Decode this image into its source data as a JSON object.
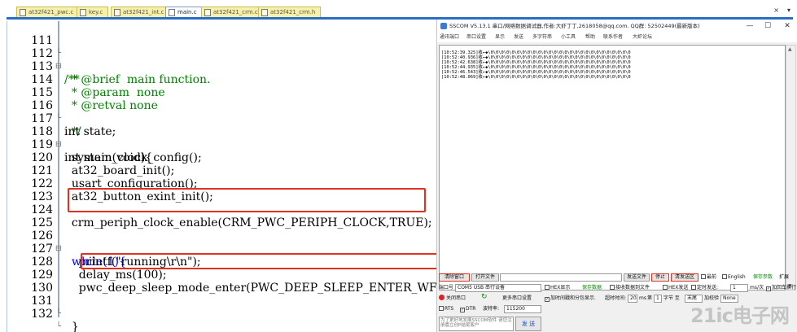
{
  "tabs": [
    {
      "label": "at32f421_pwc.c",
      "active": false
    },
    {
      "label": "key.c",
      "active": false
    },
    {
      "label": "at32f421_int.c",
      "active": false
    },
    {
      "label": "main.c",
      "active": true
    },
    {
      "label": "at32f421_crm.c",
      "active": false
    },
    {
      "label": "at32f421_crm.h",
      "active": false
    }
  ],
  "tabbar_controls": {
    "dropdown": "▾",
    "close": "×"
  },
  "editor": {
    "lines": [
      {
        "n": "111",
        "fold": "└",
        "code": ""
      },
      {
        "n": "112",
        "fold": "⊟",
        "code": "/**"
      },
      {
        "n": "113",
        "fold": "",
        "code": "  * @brief  main function."
      },
      {
        "n": "114",
        "fold": "",
        "code": "  * @param  none"
      },
      {
        "n": "115",
        "fold": "",
        "code": "  * @retval none"
      },
      {
        "n": "116",
        "fold": "└",
        "code": "  */"
      },
      {
        "n": "117",
        "fold": "",
        "code": "int state;"
      },
      {
        "n": "118",
        "fold": "⊟",
        "code": "int main(void){"
      },
      {
        "n": "119",
        "fold": "",
        "code": "  system_clock_config();"
      },
      {
        "n": "120",
        "fold": "",
        "code": "  at32_board_init();"
      },
      {
        "n": "121",
        "fold": "",
        "code": "  usart_configuration();"
      },
      {
        "n": "122",
        "fold": "",
        "code": "  at32_button_exint_init();"
      },
      {
        "n": "123",
        "fold": "",
        "code": ""
      },
      {
        "n": "124",
        "fold": "",
        "code": "  crm_periph_clock_enable(CRM_PWC_PERIPH_CLOCK,TRUE);"
      },
      {
        "n": "125",
        "fold": "",
        "code": ""
      },
      {
        "n": "126",
        "fold": "⊟",
        "code": "  while(1){"
      },
      {
        "n": "127",
        "fold": "",
        "code": "    printf(\"running\\r\\n\");"
      },
      {
        "n": "128",
        "fold": "",
        "code": "    delay_ms(100);"
      },
      {
        "n": "129",
        "fold": "",
        "code": "    pwc_deep_sleep_mode_enter(PWC_DEEP_SLEEP_ENTER_WFI);"
      },
      {
        "n": "130",
        "fold": "",
        "code": ""
      },
      {
        "n": "131",
        "fold": "└",
        "code": "  }"
      },
      {
        "n": "132",
        "fold": "└",
        "code": "}"
      }
    ]
  },
  "sscom": {
    "title": "SSCOM V5.13.1 串口/网络数据调试器,作者:大虾丁丁,2618058@qq.com. QQ群: 52502449(最新版本)",
    "window_buttons": {
      "minimize": "—",
      "maximize": "☐",
      "close": "✕"
    },
    "menu": [
      "通讯端口",
      "串口设置",
      "显示",
      "发送",
      "多字符串",
      "小工具",
      "帮助",
      "联系作者",
      "大虾论坛"
    ],
    "received": [
      "[10:52:39.325]收←◆\\0\\0\\0\\0\\0\\0\\0\\0\\0\\0\\0\\0\\0\\0\\0\\0\\0\\0\\0\\0\\0\\0\\0\\0\\0\\0\\0",
      "[10:52:40.936]收←◆\\0\\0\\0\\0\\0\\0\\0\\0\\0\\0\\0\\0\\0\\0\\0\\0\\0\\0\\0\\0\\0\\0\\0\\0\\0\\0\\0",
      "[10:52:42.638]收←◆\\0\\0\\0\\0\\0\\0\\0\\0\\0\\0\\0\\0\\0\\0\\0\\0\\0\\0\\0\\0\\0\\0\\0\\0\\0\\0\\0",
      "[10:52:44.935]收←◆\\0\\0\\0\\0\\0\\0\\0\\0\\0\\0\\0\\0\\0\\0\\0\\0\\0\\0\\0\\0\\0\\0\\0\\0\\0\\0\\0",
      "[10:52:46.543]收←◆\\0\\0\\0\\0\\0\\0\\0\\0\\0\\0\\0\\0\\0\\0\\0\\0\\0\\0\\0\\0\\0\\0\\0\\0\\0\\0\\0",
      "[10:52:48.069]收←◆\\0\\0\\0\\0\\0\\0\\0\\0\\0\\0\\0\\0\\0\\0\\0\\0\\0\\0\\0\\0\\0\\0\\0\\0\\0\\0\\0"
    ],
    "controls": {
      "clear_window": "清除窗口",
      "open_file": "打开文件",
      "send_file": "发送文件",
      "stop": "停止",
      "clear_send": "清发送区",
      "topmost": "最前",
      "english": "English",
      "save_params": "保存参数",
      "expand": "扩展",
      "port_label": "端口号",
      "port_value": "COM5 USB 串行设备",
      "hex_display": "HEX显示",
      "save_data": "保存数据",
      "recv_to_file": "接收数据到文件",
      "hex_send": "HEX发送",
      "timed_send": "定时发送:",
      "interval": "1",
      "interval_unit": "ms/次",
      "add_crlf": "加回车换行",
      "close_port": "关闭串口",
      "more_port_settings": "更多串口设置",
      "timestamp_label": "加时间戳和分包显示.",
      "timeout_label": "超时时间:",
      "timeout_value": "20",
      "ms_label": "ms",
      "nth_label": "第",
      "byte_value": "1",
      "byte_label": "字节 至",
      "end_value": "末尾",
      "checksum_label": "加校验",
      "checksum_value": "None",
      "rts": "RTS",
      "dtr": "DTR",
      "baud_label": "波特率:",
      "baud_value": "115200",
      "send_text": "为了更好地发展SSCOM软件 请您注册嘉立创P结尾客户",
      "send_button": "发 送"
    },
    "watermark": "21ic电子网"
  }
}
